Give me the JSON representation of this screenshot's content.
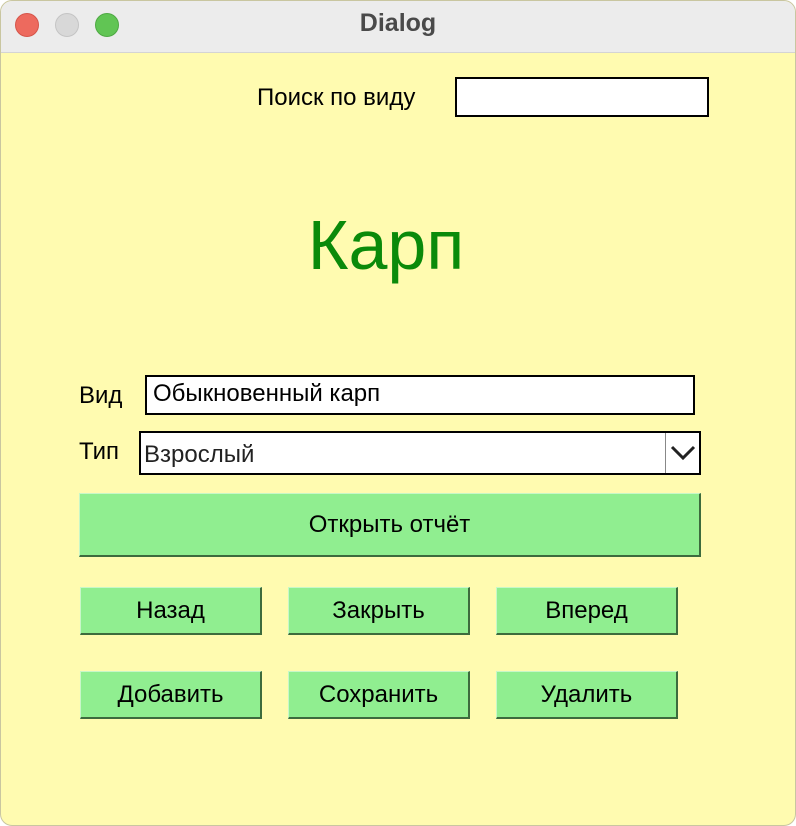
{
  "window": {
    "title": "Dialog"
  },
  "search": {
    "label": "Поиск по виду",
    "value": ""
  },
  "header": {
    "title": "Карп",
    "title_color": "#0a8a0a"
  },
  "form": {
    "species_label": "Вид",
    "species_value": "Обыкновенный карп",
    "type_label": "Тип",
    "type_value": "Взрослый"
  },
  "buttons": {
    "open_report": "Открыть отчёт",
    "back": "Назад",
    "close": "Закрыть",
    "forward": "Вперед",
    "add": "Добавить",
    "save": "Сохранить",
    "delete": "Удалить"
  },
  "colors": {
    "background": "#fffbb0",
    "button": "#90ee90"
  }
}
